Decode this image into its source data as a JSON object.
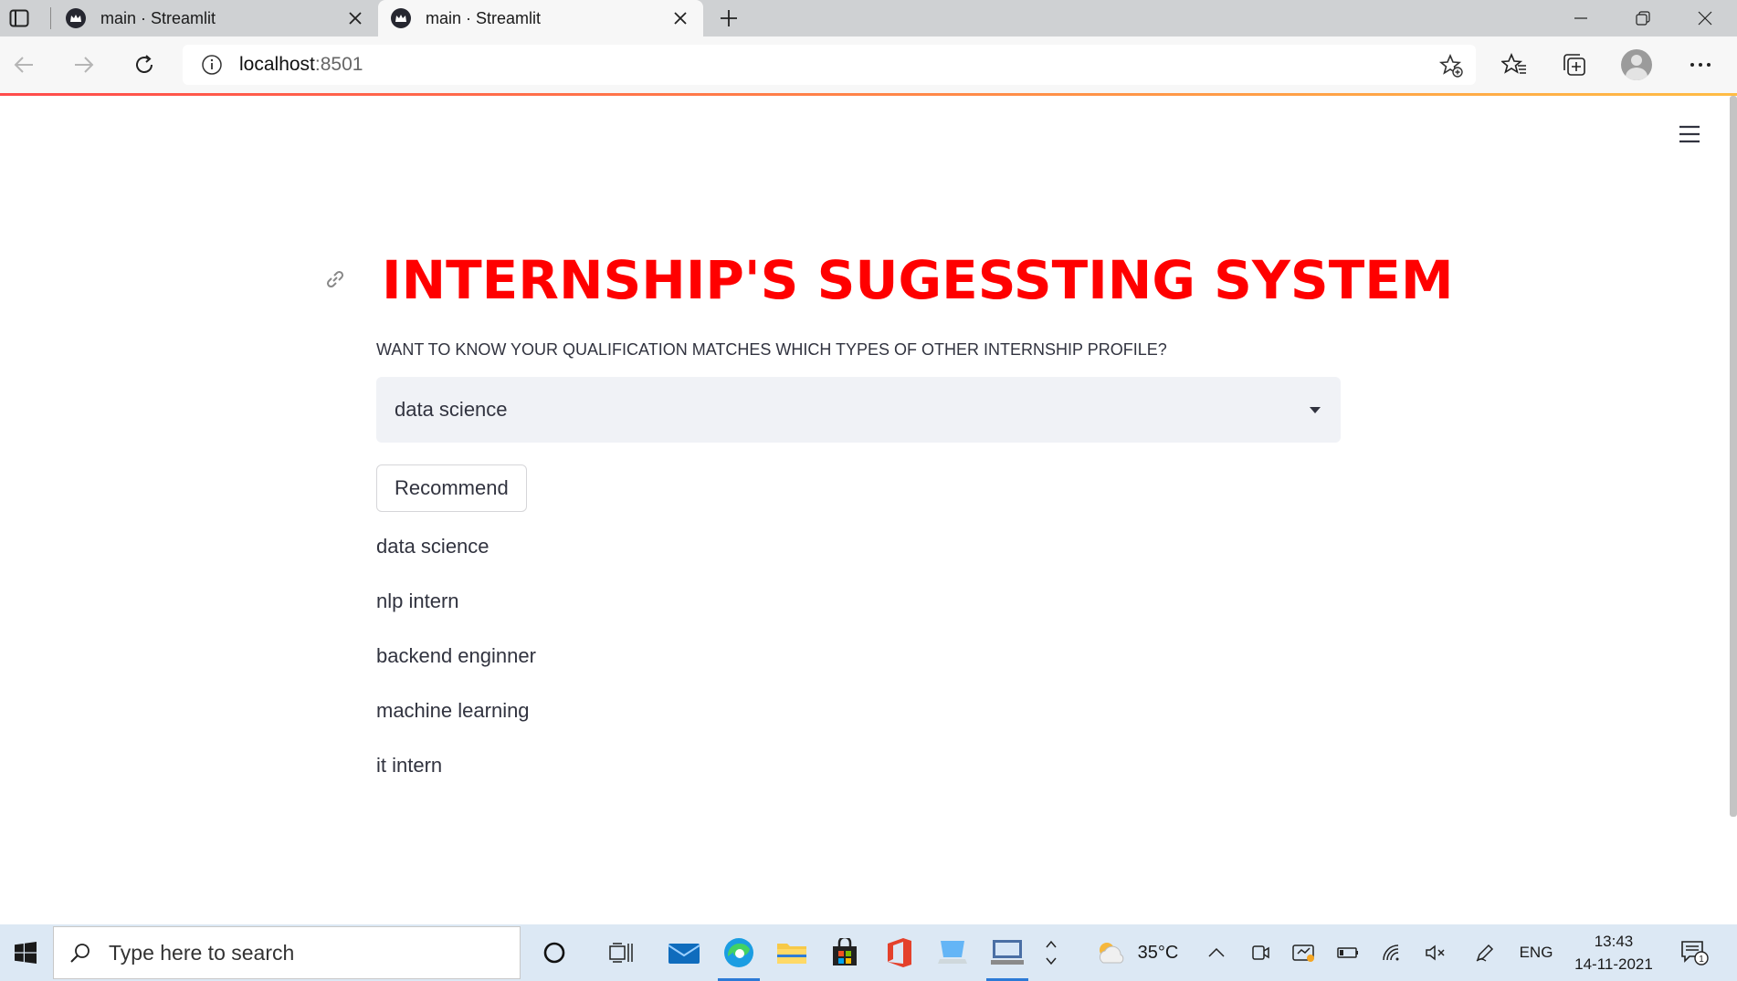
{
  "browser": {
    "tabs": [
      {
        "title": "main · Streamlit"
      },
      {
        "title": "main · Streamlit"
      }
    ],
    "url_host": "localhost",
    "url_port": ":8501"
  },
  "app": {
    "title": "INTERNSHIP'S SUGESSTING SYSTEM",
    "select_label": "WANT TO KNOW YOUR QUALIFICATION MATCHES WHICH TYPES OF OTHER INTERNSHIP PROFILE?",
    "select_value": "data science",
    "button_label": "Recommend",
    "results": [
      "data science",
      "nlp intern",
      "backend enginner",
      "machine learning",
      "it intern"
    ],
    "title_color": "#ff0000"
  },
  "taskbar": {
    "search_placeholder": "Type here to search",
    "weather": "35°C",
    "language": "ENG",
    "time": "13:43",
    "date": "14-11-2021",
    "notification_count": "1"
  }
}
